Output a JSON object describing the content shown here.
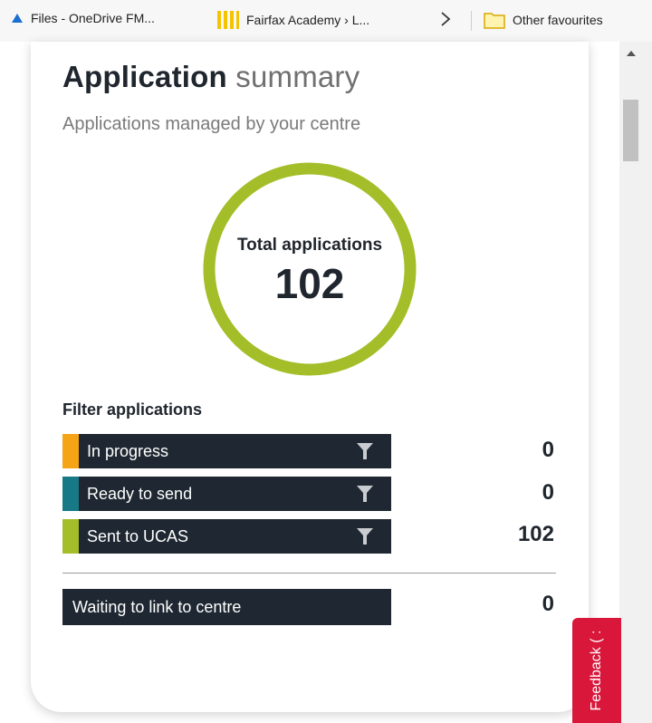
{
  "bookmarks": [
    {
      "label": "Files - OneDrive FM...",
      "icon": "onedrive-icon"
    },
    {
      "label": "Fairfax Academy › L...",
      "icon": "yellow-bars-icon"
    },
    {
      "label": "Other favourites",
      "icon": "folder-icon"
    }
  ],
  "card": {
    "title_bold": "Application",
    "title_light": "summary",
    "subtitle": "Applications managed by your centre"
  },
  "donut": {
    "label": "Total applications",
    "total": "102",
    "ring_color": "#a3be28"
  },
  "filters": {
    "heading": "Filter applications",
    "items": [
      {
        "label": "In progress",
        "count": "0",
        "color": "#f5a416"
      },
      {
        "label": "Ready to send",
        "count": "0",
        "color": "#177985"
      },
      {
        "label": "Sent to UCAS",
        "count": "102",
        "color": "#a3be28"
      }
    ]
  },
  "waiting": {
    "label": "Waiting to link to centre",
    "count": "0"
  },
  "feedback": {
    "label": "Feedback ( :"
  }
}
